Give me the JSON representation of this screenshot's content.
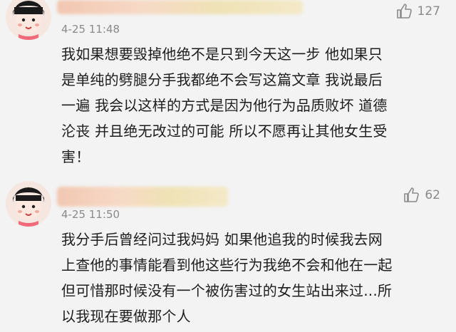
{
  "comments": [
    {
      "time": "4-25 11:48",
      "likes": "127",
      "lines": [
        "我如果想要毁掉他绝不是只到今天这一步 他如果只",
        "是单纯的劈腿分手我都绝不会写这篇文章 我说最后",
        "一遍 我会以这样的方式是因为他行为品质败坏 道德",
        "沦丧 并且绝无改过的可能 所以不愿再让其他女生受",
        "害！"
      ]
    },
    {
      "time": "4-25 11:50",
      "likes": "62",
      "lines": [
        "我分手后曾经问过我妈妈 如果他追我的时候我去网",
        "上查他的事情能看到他这些行为我绝不会和他在一起",
        "但可惜那时候没有一个被伤害过的女生站出来过...所",
        "以我现在要做那个人"
      ]
    }
  ],
  "icons": {
    "like": "thumbs-up-icon",
    "avatar": "avatar-cartoon"
  }
}
